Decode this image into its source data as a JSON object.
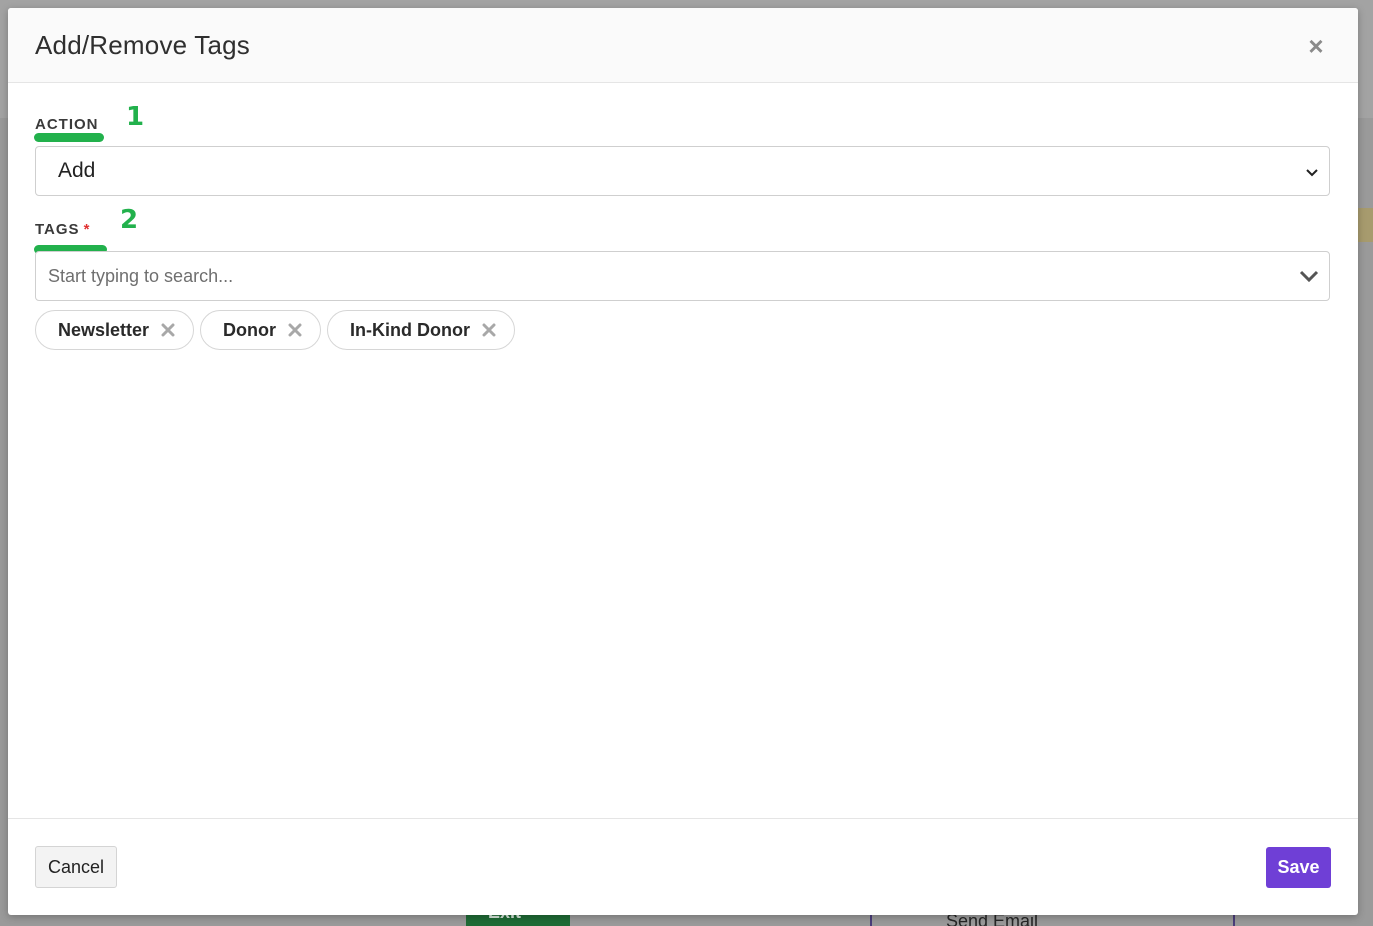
{
  "background": {
    "exit_label": "Exit",
    "send_email_label": "Send Email"
  },
  "modal": {
    "title": "Add/Remove Tags",
    "close_glyph": "×"
  },
  "action_field": {
    "label": "ACTION",
    "marker": "1",
    "selected_value": "Add"
  },
  "tags_field": {
    "label": "TAGS",
    "required_mark": "*",
    "marker": "2",
    "placeholder": "Start typing to search..."
  },
  "tags": [
    {
      "label": "Newsletter"
    },
    {
      "label": "Donor"
    },
    {
      "label": "In-Kind Donor"
    }
  ],
  "footer": {
    "cancel_label": "Cancel",
    "save_label": "Save"
  },
  "colors": {
    "accent": "#6f3fd6",
    "annotation": "#22b14c",
    "required": "#e03030"
  }
}
